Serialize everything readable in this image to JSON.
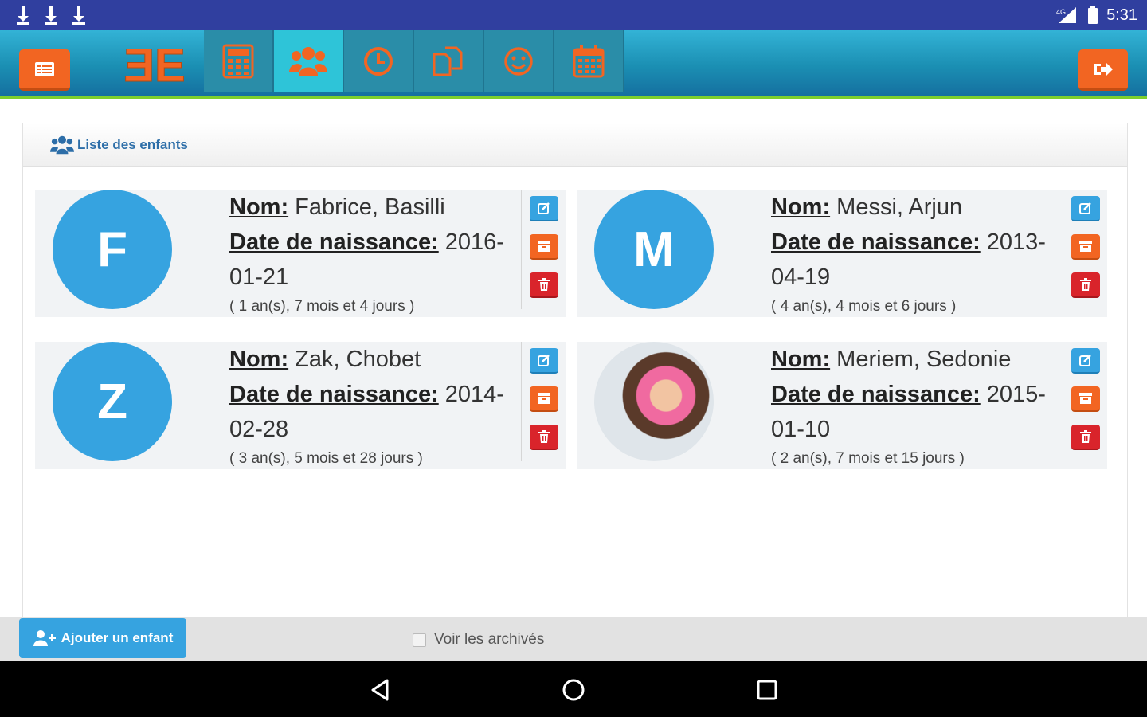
{
  "status_bar": {
    "time": "5:31",
    "network_label": "4G"
  },
  "header": {
    "logo_text": "ƎE",
    "tabs": [
      {
        "icon": "calculator-icon",
        "active": false
      },
      {
        "icon": "users-icon",
        "active": true
      },
      {
        "icon": "clock-icon",
        "active": false
      },
      {
        "icon": "copy-icon",
        "active": false
      },
      {
        "icon": "smile-icon",
        "active": false
      },
      {
        "icon": "calendar-icon",
        "active": false
      }
    ]
  },
  "panel": {
    "title": "Liste des enfants"
  },
  "children": [
    {
      "initial": "F",
      "nom_label": "Nom:",
      "nom": "Fabrice, Basilli",
      "dob_label": "Date de naissance:",
      "dob_part1": "2016-",
      "dob_part2": "01-21",
      "age": "( 1 an(s), 7 mois et 4 jours )"
    },
    {
      "initial": "M",
      "nom_label": "Nom:",
      "nom": "Messi, Arjun",
      "dob_label": "Date de naissance:",
      "dob_part1": "2013-",
      "dob_part2": "04-19",
      "age": "( 4 an(s), 4 mois et 6 jours )"
    },
    {
      "initial": "Z",
      "nom_label": "Nom:",
      "nom": "Zak, Chobet",
      "dob_label": "Date de naissance:",
      "dob_part1": "2014-",
      "dob_part2": "02-28",
      "age": "( 3 an(s), 5 mois et 28 jours )"
    },
    {
      "initial": "",
      "nom_label": "Nom:",
      "nom": "Meriem, Sedonie",
      "dob_label": "Date de naissance:",
      "dob_part1": "2015-",
      "dob_part2": "01-10",
      "age": "( 2 an(s), 7 mois et 15 jours )"
    }
  ],
  "footer": {
    "add_label": "Ajouter un enfant",
    "archives_label": "Voir les archivés",
    "archives_checked": false
  },
  "colors": {
    "primary": "#36a3e0",
    "accent": "#f26522",
    "danger": "#d9242b",
    "statusbar": "#303f9f",
    "highlight": "#7dcf2d"
  }
}
